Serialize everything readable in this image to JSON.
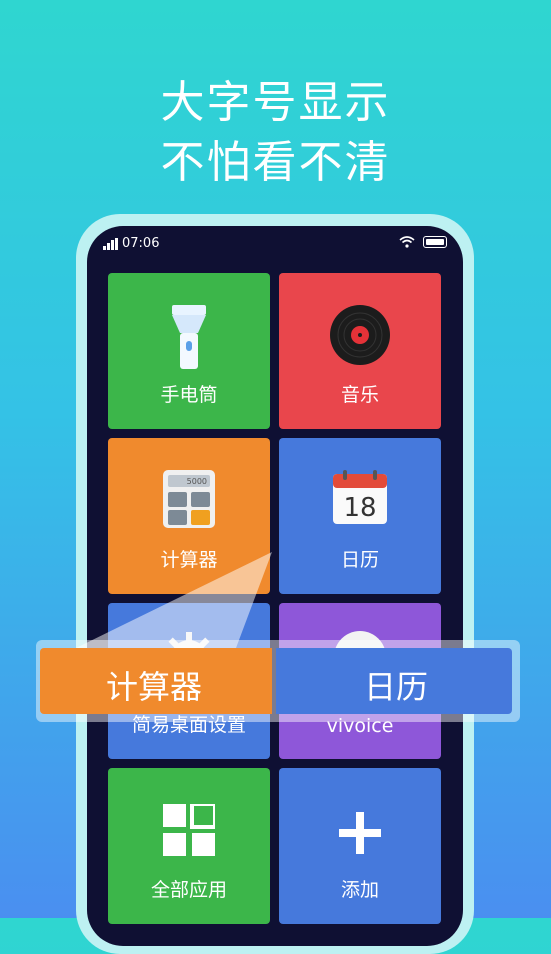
{
  "headline": {
    "line1": "大字号显示",
    "line2": "不怕看不清"
  },
  "status_bar": {
    "time": "07:06"
  },
  "tiles": [
    {
      "label": "手电筒",
      "icon": "flashlight-icon"
    },
    {
      "label": "音乐",
      "icon": "vinyl-record-icon"
    },
    {
      "label": "计算器",
      "icon": "calculator-icon",
      "display": "5000"
    },
    {
      "label": "日历",
      "icon": "calendar-icon",
      "day": "18"
    },
    {
      "label": "简易桌面设置",
      "icon": "gear-icon"
    },
    {
      "label": "vivoice",
      "icon": "voice-icon"
    },
    {
      "label": "全部应用",
      "icon": "grid-icon"
    },
    {
      "label": "添加",
      "icon": "plus-icon"
    }
  ],
  "magnified": {
    "left": "计算器",
    "right": "日历"
  },
  "colors": {
    "green": "#3cb64a",
    "red": "#e9464c",
    "orange": "#f08a2d",
    "blue": "#4679dc",
    "purple": "#8e57d9",
    "screen": "#0f1033"
  }
}
